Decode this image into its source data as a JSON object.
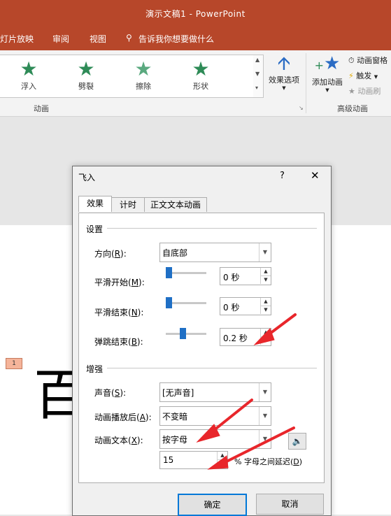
{
  "window": {
    "title": "演示文稿1  -  PowerPoint"
  },
  "menu": {
    "items": [
      "灯片放映",
      "审阅",
      "视图"
    ],
    "tell_me": "告诉我你想要做什么"
  },
  "ribbon": {
    "gallery": [
      {
        "label": "浮入",
        "icon": "float-in-star-icon"
      },
      {
        "label": "劈裂",
        "icon": "split-star-icon"
      },
      {
        "label": "擦除",
        "icon": "wipe-star-icon"
      },
      {
        "label": "形状",
        "icon": "shape-star-icon"
      }
    ],
    "group_animation": "动画",
    "effect_options": "效果选项",
    "add_animation": "添加动画",
    "animation_pane": "动画窗格",
    "trigger": "触发",
    "painter": "动画刷",
    "group_advanced": "高级动画"
  },
  "slide": {
    "badge": "1",
    "char": "百"
  },
  "dialog": {
    "title": "飞入",
    "help": "?",
    "close": "✕",
    "tabs": [
      "效果",
      "计时",
      "正文文本动画"
    ],
    "settings": {
      "section": "设置",
      "direction_label": "方向(",
      "direction_key": "R",
      "direction_value": "自底部",
      "smooth_start_label": "平滑开始(",
      "smooth_start_key": "M",
      "smooth_start_value": "0 秒",
      "smooth_end_label": "平滑结束(",
      "smooth_end_key": "N",
      "smooth_end_value": "0 秒",
      "bounce_label": "弹跳结束(",
      "bounce_key": "B",
      "bounce_value": "0.2 秒"
    },
    "enhance": {
      "section": "增强",
      "sound_label": "声音(",
      "sound_key": "S",
      "sound_value": "[无声音]",
      "after_label": "动画播放后(",
      "after_key": "A",
      "after_value": "不变暗",
      "text_label": "动画文本(",
      "text_key": "X",
      "text_value": "按字母",
      "delay_value": "15",
      "delay_suffix": "% 字母之间延迟(",
      "delay_key": "D"
    },
    "ok": "确定",
    "cancel": "取消"
  },
  "colors": {
    "accent": "#b7472a",
    "arrow": "#e8262b",
    "star": "#2e8b57"
  }
}
